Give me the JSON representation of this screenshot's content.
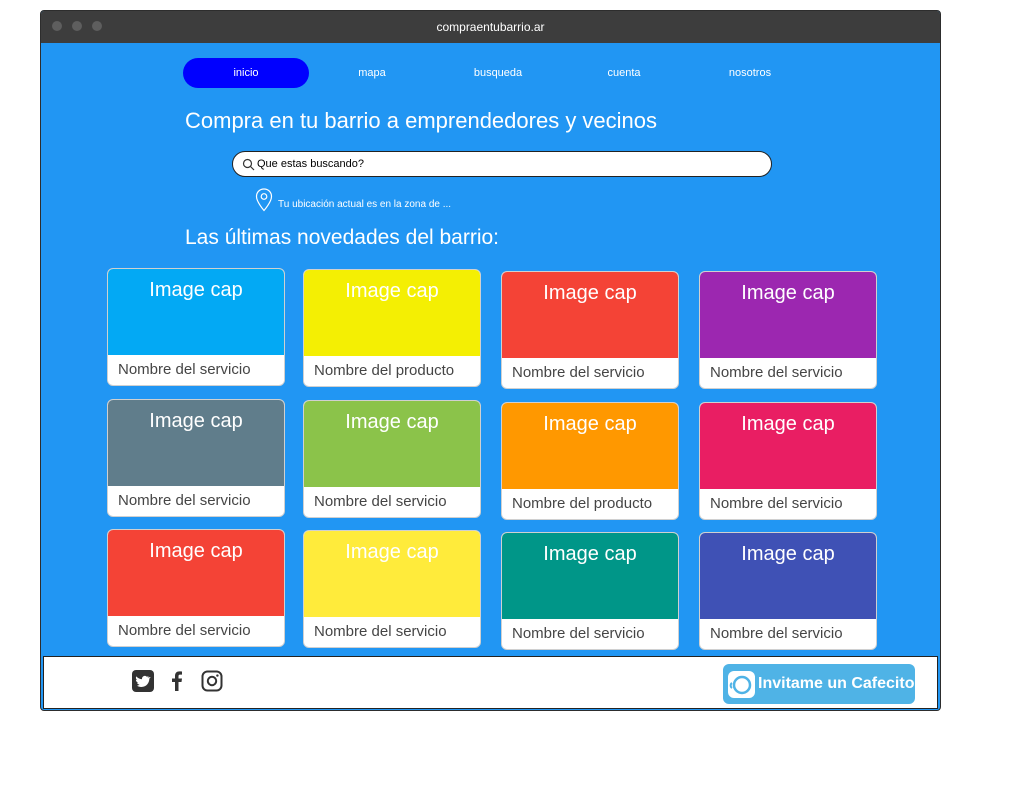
{
  "browser": {
    "url": "compraentubarrio.ar"
  },
  "nav": {
    "items": [
      {
        "label": "inicio"
      },
      {
        "label": "mapa"
      },
      {
        "label": "busqueda"
      },
      {
        "label": "cuenta"
      },
      {
        "label": "nosotros"
      }
    ]
  },
  "hero": {
    "title": "Compra en tu barrio a emprendedores y vecinos"
  },
  "search": {
    "placeholder": "Que estas buscando?"
  },
  "location": {
    "text": "Tu ubicación actual es en la zona de ..."
  },
  "section": {
    "title": "Las últimas novedades del barrio:"
  },
  "cards": [
    {
      "cap": "Image cap",
      "name": "Nombre del servicio",
      "color": "#03a9f4"
    },
    {
      "cap": "Image cap",
      "name": "Nombre del producto",
      "color": "#f4ef03"
    },
    {
      "cap": "Image cap",
      "name": "Nombre del servicio",
      "color": "#f44336"
    },
    {
      "cap": "Image cap",
      "name": "Nombre del servicio",
      "color": "#9c27b0"
    },
    {
      "cap": "Image cap",
      "name": "Nombre del servicio",
      "color": "#607d8b"
    },
    {
      "cap": "Image cap",
      "name": "Nombre del servicio",
      "color": "#8bc34a"
    },
    {
      "cap": "Image cap",
      "name": "Nombre del producto",
      "color": "#ff9800"
    },
    {
      "cap": "Image cap",
      "name": "Nombre del servicio",
      "color": "#e91e63"
    },
    {
      "cap": "Image cap",
      "name": "Nombre del servicio",
      "color": "#f44336"
    },
    {
      "cap": "Image cap",
      "name": "Nombre del servicio",
      "color": "#ffeb3b"
    },
    {
      "cap": "Image cap",
      "name": "Nombre del servicio",
      "color": "#009688"
    },
    {
      "cap": "Image cap",
      "name": "Nombre del servicio",
      "color": "#3f51b5"
    }
  ],
  "footer": {
    "social": [
      {
        "icon": "twitter-icon"
      },
      {
        "icon": "facebook-icon"
      },
      {
        "icon": "instagram-icon"
      }
    ],
    "cafecito_label": "Invitame un Cafecito"
  },
  "colors": {
    "page_bg": "#2196f3",
    "nav_active": "#0000ff",
    "titlebar": "#3d3d3d",
    "cafecito": "#4fb3e6"
  }
}
